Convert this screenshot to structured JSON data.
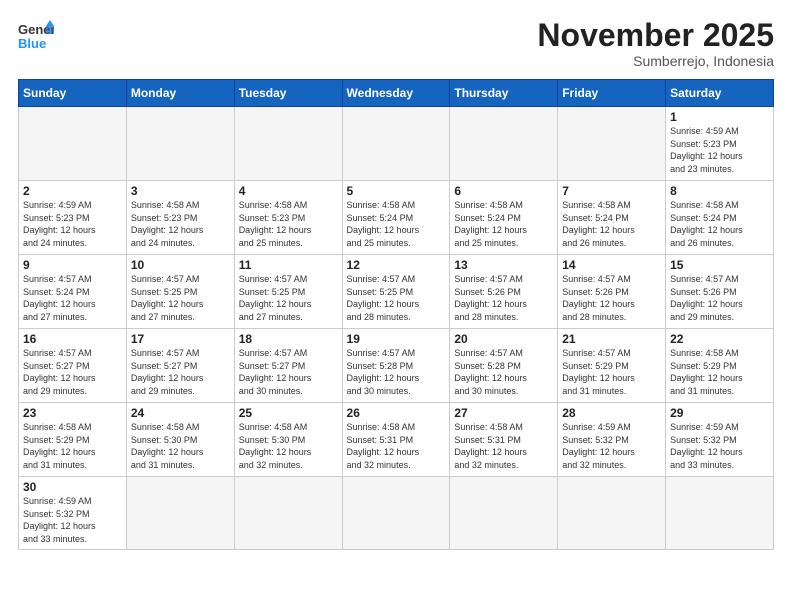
{
  "header": {
    "logo_general": "General",
    "logo_blue": "Blue",
    "month_title": "November 2025",
    "subtitle": "Sumberrejo, Indonesia"
  },
  "weekdays": [
    "Sunday",
    "Monday",
    "Tuesday",
    "Wednesday",
    "Thursday",
    "Friday",
    "Saturday"
  ],
  "cells": [
    {
      "day": "",
      "info": ""
    },
    {
      "day": "",
      "info": ""
    },
    {
      "day": "",
      "info": ""
    },
    {
      "day": "",
      "info": ""
    },
    {
      "day": "",
      "info": ""
    },
    {
      "day": "",
      "info": ""
    },
    {
      "day": "1",
      "info": "Sunrise: 4:59 AM\nSunset: 5:23 PM\nDaylight: 12 hours\nand 23 minutes."
    },
    {
      "day": "2",
      "info": "Sunrise: 4:59 AM\nSunset: 5:23 PM\nDaylight: 12 hours\nand 24 minutes."
    },
    {
      "day": "3",
      "info": "Sunrise: 4:58 AM\nSunset: 5:23 PM\nDaylight: 12 hours\nand 24 minutes."
    },
    {
      "day": "4",
      "info": "Sunrise: 4:58 AM\nSunset: 5:23 PM\nDaylight: 12 hours\nand 25 minutes."
    },
    {
      "day": "5",
      "info": "Sunrise: 4:58 AM\nSunset: 5:24 PM\nDaylight: 12 hours\nand 25 minutes."
    },
    {
      "day": "6",
      "info": "Sunrise: 4:58 AM\nSunset: 5:24 PM\nDaylight: 12 hours\nand 25 minutes."
    },
    {
      "day": "7",
      "info": "Sunrise: 4:58 AM\nSunset: 5:24 PM\nDaylight: 12 hours\nand 26 minutes."
    },
    {
      "day": "8",
      "info": "Sunrise: 4:58 AM\nSunset: 5:24 PM\nDaylight: 12 hours\nand 26 minutes."
    },
    {
      "day": "9",
      "info": "Sunrise: 4:57 AM\nSunset: 5:24 PM\nDaylight: 12 hours\nand 27 minutes."
    },
    {
      "day": "10",
      "info": "Sunrise: 4:57 AM\nSunset: 5:25 PM\nDaylight: 12 hours\nand 27 minutes."
    },
    {
      "day": "11",
      "info": "Sunrise: 4:57 AM\nSunset: 5:25 PM\nDaylight: 12 hours\nand 27 minutes."
    },
    {
      "day": "12",
      "info": "Sunrise: 4:57 AM\nSunset: 5:25 PM\nDaylight: 12 hours\nand 28 minutes."
    },
    {
      "day": "13",
      "info": "Sunrise: 4:57 AM\nSunset: 5:26 PM\nDaylight: 12 hours\nand 28 minutes."
    },
    {
      "day": "14",
      "info": "Sunrise: 4:57 AM\nSunset: 5:26 PM\nDaylight: 12 hours\nand 28 minutes."
    },
    {
      "day": "15",
      "info": "Sunrise: 4:57 AM\nSunset: 5:26 PM\nDaylight: 12 hours\nand 29 minutes."
    },
    {
      "day": "16",
      "info": "Sunrise: 4:57 AM\nSunset: 5:27 PM\nDaylight: 12 hours\nand 29 minutes."
    },
    {
      "day": "17",
      "info": "Sunrise: 4:57 AM\nSunset: 5:27 PM\nDaylight: 12 hours\nand 29 minutes."
    },
    {
      "day": "18",
      "info": "Sunrise: 4:57 AM\nSunset: 5:27 PM\nDaylight: 12 hours\nand 30 minutes."
    },
    {
      "day": "19",
      "info": "Sunrise: 4:57 AM\nSunset: 5:28 PM\nDaylight: 12 hours\nand 30 minutes."
    },
    {
      "day": "20",
      "info": "Sunrise: 4:57 AM\nSunset: 5:28 PM\nDaylight: 12 hours\nand 30 minutes."
    },
    {
      "day": "21",
      "info": "Sunrise: 4:57 AM\nSunset: 5:29 PM\nDaylight: 12 hours\nand 31 minutes."
    },
    {
      "day": "22",
      "info": "Sunrise: 4:58 AM\nSunset: 5:29 PM\nDaylight: 12 hours\nand 31 minutes."
    },
    {
      "day": "23",
      "info": "Sunrise: 4:58 AM\nSunset: 5:29 PM\nDaylight: 12 hours\nand 31 minutes."
    },
    {
      "day": "24",
      "info": "Sunrise: 4:58 AM\nSunset: 5:30 PM\nDaylight: 12 hours\nand 31 minutes."
    },
    {
      "day": "25",
      "info": "Sunrise: 4:58 AM\nSunset: 5:30 PM\nDaylight: 12 hours\nand 32 minutes."
    },
    {
      "day": "26",
      "info": "Sunrise: 4:58 AM\nSunset: 5:31 PM\nDaylight: 12 hours\nand 32 minutes."
    },
    {
      "day": "27",
      "info": "Sunrise: 4:58 AM\nSunset: 5:31 PM\nDaylight: 12 hours\nand 32 minutes."
    },
    {
      "day": "28",
      "info": "Sunrise: 4:59 AM\nSunset: 5:32 PM\nDaylight: 12 hours\nand 32 minutes."
    },
    {
      "day": "29",
      "info": "Sunrise: 4:59 AM\nSunset: 5:32 PM\nDaylight: 12 hours\nand 33 minutes."
    },
    {
      "day": "30",
      "info": "Sunrise: 4:59 AM\nSunset: 5:32 PM\nDaylight: 12 hours\nand 33 minutes."
    },
    {
      "day": "",
      "info": ""
    },
    {
      "day": "",
      "info": ""
    },
    {
      "day": "",
      "info": ""
    },
    {
      "day": "",
      "info": ""
    },
    {
      "day": "",
      "info": ""
    },
    {
      "day": "",
      "info": ""
    },
    {
      "day": "",
      "info": ""
    }
  ]
}
